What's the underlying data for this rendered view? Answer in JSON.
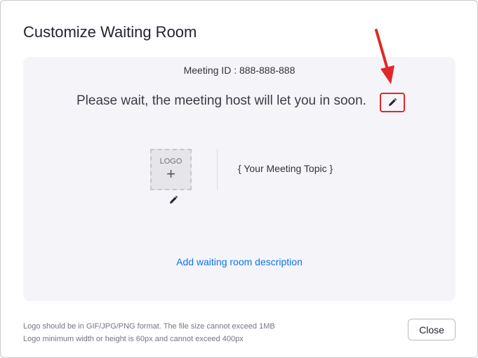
{
  "dialog": {
    "title": "Customize Waiting Room",
    "meeting_id": "Meeting ID : 888-888-888",
    "waiting_message": "Please wait, the meeting host will let you in soon.",
    "logo_placeholder": "LOGO",
    "logo_plus": "+",
    "meeting_topic": "{ Your Meeting Topic }",
    "add_description": "Add waiting room description",
    "note_line1": "Logo should be in GIF/JPG/PNG format. The file size cannot exceed 1MB",
    "note_line2": "Logo minimum width or height is 60px and cannot exceed 400px",
    "close_label": "Close"
  },
  "colors": {
    "accent_link": "#0e72ed",
    "highlight_red": "#e02828",
    "panel_bg": "#f5f5f9"
  },
  "icons": [
    "pencil-icon",
    "red-arrow-annotation"
  ]
}
